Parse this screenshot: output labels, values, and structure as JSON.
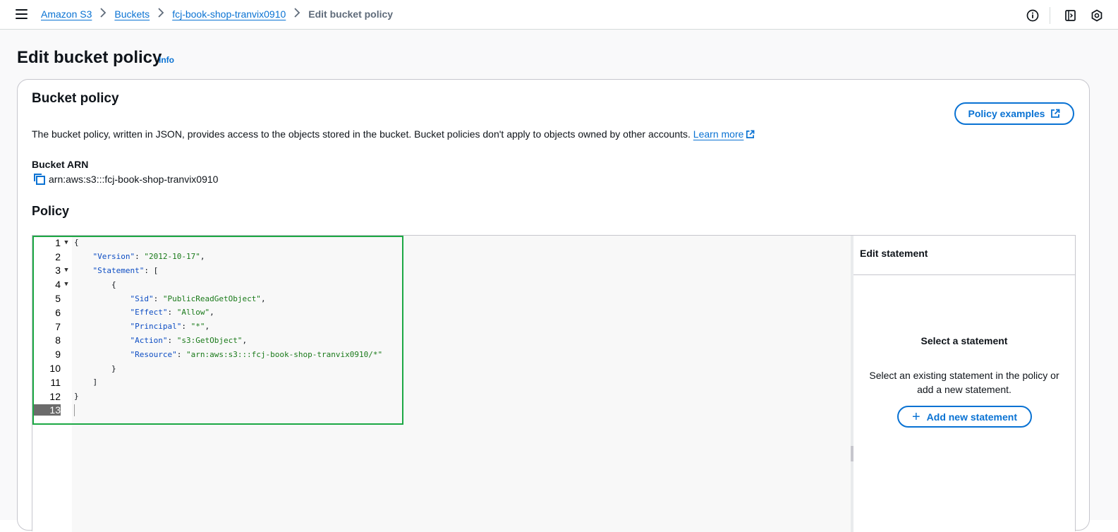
{
  "breadcrumbs": [
    {
      "label": "Amazon S3"
    },
    {
      "label": "Buckets"
    },
    {
      "label": "fcj-book-shop-tranvix0910"
    },
    {
      "label": "Edit bucket policy"
    }
  ],
  "header_icons": [
    "info-icon",
    "notes-icon",
    "settings-hex-icon"
  ],
  "page": {
    "title": "Edit bucket policy",
    "info_link": "Info"
  },
  "bucket_policy": {
    "title": "Bucket policy",
    "policy_examples_label": "Policy examples",
    "description": "The bucket policy, written in JSON, provides access to the objects stored in the bucket. Bucket policies don't apply to objects owned by other accounts.",
    "learn_more": "Learn more",
    "arn_label": "Bucket ARN",
    "arn_value": "arn:aws:s3:::fcj-book-shop-tranvix0910",
    "policy_label": "Policy"
  },
  "editor": {
    "lines": [
      {
        "n": "1",
        "fold": "▼",
        "text": "{"
      },
      {
        "n": "2",
        "fold": "",
        "text": "    \"Version\": \"2012-10-17\","
      },
      {
        "n": "3",
        "fold": "▼",
        "text": "    \"Statement\": ["
      },
      {
        "n": "4",
        "fold": "▼",
        "text": "        {"
      },
      {
        "n": "5",
        "fold": "",
        "text": "            \"Sid\": \"PublicReadGetObject\","
      },
      {
        "n": "6",
        "fold": "",
        "text": "            \"Effect\": \"Allow\","
      },
      {
        "n": "7",
        "fold": "",
        "text": "            \"Principal\": \"*\","
      },
      {
        "n": "8",
        "fold": "",
        "text": "            \"Action\": \"s3:GetObject\","
      },
      {
        "n": "9",
        "fold": "",
        "text": "            \"Resource\": \"arn:aws:s3:::fcj-book-shop-tranvix0910/*\""
      },
      {
        "n": "10",
        "fold": "",
        "text": "        }"
      },
      {
        "n": "11",
        "fold": "",
        "text": "    ]"
      },
      {
        "n": "12",
        "fold": "",
        "text": "}"
      },
      {
        "n": "13",
        "fold": "",
        "text": ""
      }
    ],
    "active_line": 13
  },
  "statement_panel": {
    "header": "Edit statement",
    "empty_title": "Select a statement",
    "empty_desc": "Select an existing statement in the policy or add a new statement.",
    "add_button": "Add new statement"
  },
  "colors": {
    "link": "#0972d3",
    "highlight": "#1ca844",
    "json_key": "#0d4dc3",
    "json_string": "#1a7a1a"
  }
}
